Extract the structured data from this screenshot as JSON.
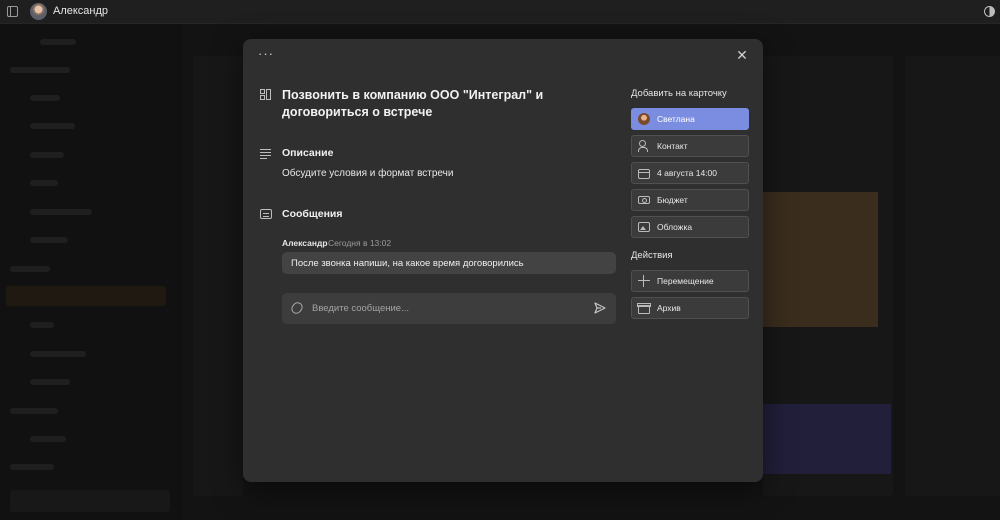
{
  "topbar": {
    "user_name": "Александр"
  },
  "modal": {
    "card_title": "Позвонить в компанию ООО \"Интеграл\" и договориться о встрече",
    "description": {
      "heading": "Описание",
      "text": "Обсудите условия и формат встречи"
    },
    "messages": {
      "heading": "Сообщения",
      "items": [
        {
          "author": "Александр",
          "time": "Сегодня в 13:02",
          "text": "После звонка напиши, на какое время договорились"
        }
      ],
      "compose_placeholder": "Введите сообщение..."
    },
    "add_to_card": {
      "heading": "Добавить на карточку",
      "buttons": [
        {
          "label": "Светлана",
          "icon": "avatar",
          "active": true
        },
        {
          "label": "Контакт",
          "icon": "contact-icon"
        },
        {
          "label": "4 августа 14:00",
          "icon": "calendar-icon"
        },
        {
          "label": "Бюджет",
          "icon": "budget-icon"
        },
        {
          "label": "Обложка",
          "icon": "image-icon"
        }
      ]
    },
    "actions": {
      "heading": "Действия",
      "buttons": [
        {
          "label": "Перемещение",
          "icon": "move-icon"
        },
        {
          "label": "Архив",
          "icon": "archive-icon"
        }
      ]
    }
  },
  "colors": {
    "accent": "#7b8de0",
    "modal_bg": "#2f2f2f",
    "page_bg": "#232323"
  }
}
